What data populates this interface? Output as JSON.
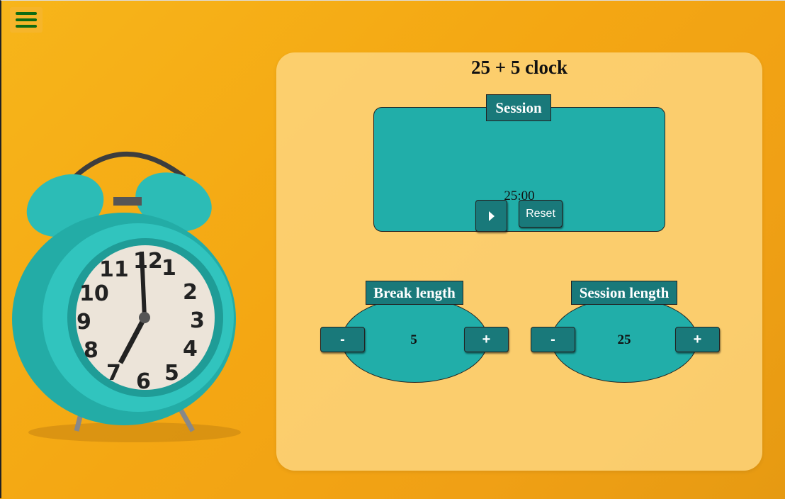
{
  "app": {
    "title": "25 + 5 clock",
    "menu_icon": "hamburger-icon"
  },
  "colors": {
    "accent": "#19797a",
    "panel_teal": "#21aea9",
    "menu_icon": "#0f6b12",
    "background": "#f4a713"
  },
  "session_panel": {
    "label": "Session",
    "time": "25:00",
    "play_icon": "play-icon",
    "reset_label": "Reset"
  },
  "break_length": {
    "label": "Break length",
    "value": "5",
    "decrement": "-",
    "increment": "+"
  },
  "session_length": {
    "label": "Session length",
    "value": "25",
    "decrement": "-",
    "increment": "+"
  }
}
